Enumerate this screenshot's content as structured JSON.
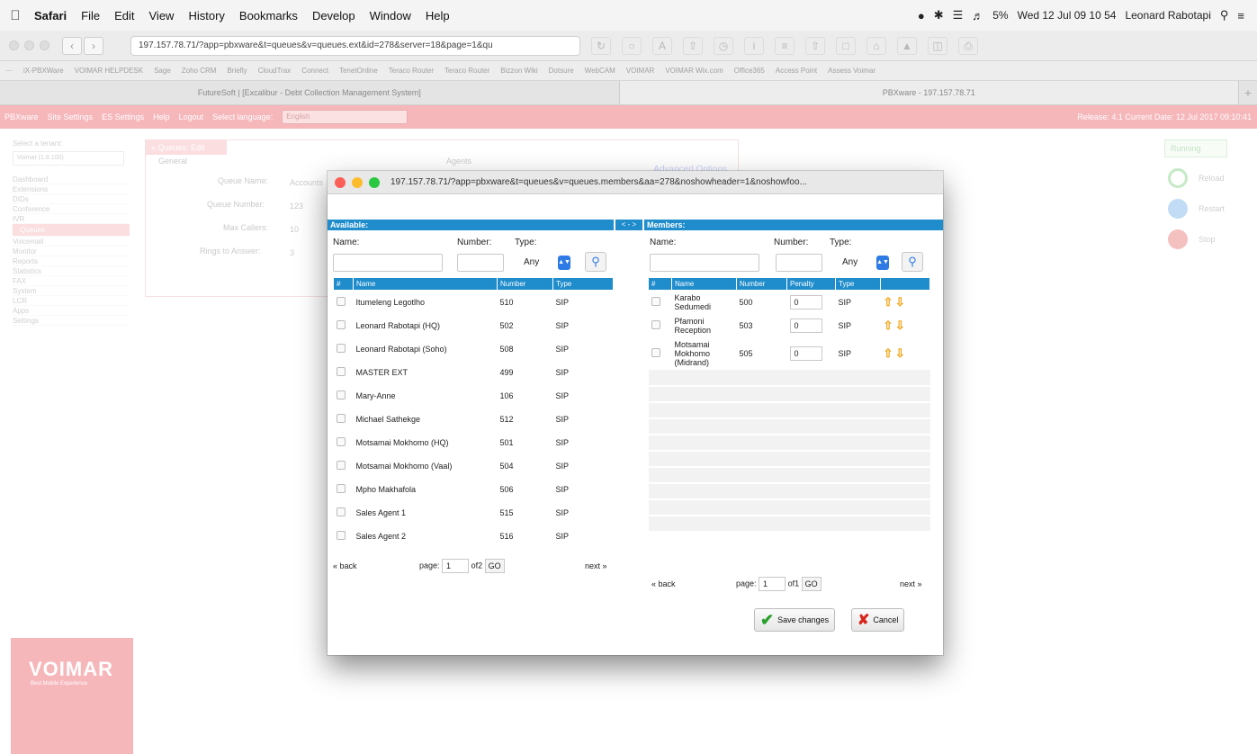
{
  "menubar": {
    "app": "Safari",
    "items": [
      "File",
      "Edit",
      "View",
      "History",
      "Bookmarks",
      "Develop",
      "Window",
      "Help"
    ],
    "battery": "5%",
    "clock": "Wed 12 Jul  09 10 54",
    "user": "Leonard Rabotapi"
  },
  "browser": {
    "url": "197.157.78.71/?app=pbxware&t=queues&v=queues.ext&id=278&server=18&page=1&qu",
    "bookmarks": [
      "iX-PBXWare",
      "VOIMAR HELPDESK",
      "Sage",
      "Zoho CRM",
      "Briefly",
      "CloudTrax",
      "Connect",
      "TenetOnline",
      "Teraco Router",
      "Teraco Router",
      "Bizzon Wiki",
      "Dotsure",
      "WebCAM",
      "VOIMAR",
      "VOIMAR Wix.com",
      "Office365",
      "Access Point",
      "Assess Voimar"
    ],
    "tabs": [
      "FutureSoft | [Excalibur - Debt Collection Management System]",
      "PBXware - 197.157.78.71"
    ]
  },
  "pbxbar": {
    "items": [
      "PBXware",
      "Site Settings",
      "ES Settings",
      "Help",
      "Logout",
      "Select language:"
    ],
    "language": "English",
    "right": "Release: 4.1   Current Date: 12 Jul 2017 09:10:41"
  },
  "background": {
    "tenant_label": "Select a tenant:",
    "tenant_value": "Voimar (1.8.100)",
    "nav": [
      "Dashboard",
      "Extensions",
      "DIDs",
      "Conference",
      "IVR",
      "Queues",
      "Voicemail",
      "Monitor",
      "Reports",
      "Statistics",
      "FAX",
      "System",
      "LCR",
      "Apps",
      "Settings"
    ],
    "selected_nav": "Queues",
    "panel_title": "« Queues: Edit",
    "advanced": "Advanced Options",
    "general": "General",
    "agents": "Agents",
    "fields": [
      "Queue Name:",
      "Queue Number:",
      "Max Callers:",
      "Rings to Answer:"
    ],
    "field_values": [
      "Accounts",
      "123",
      "10",
      "3"
    ],
    "status": "Running",
    "controls": [
      "Reload",
      "Restart",
      "Stop"
    ],
    "logo": "VOIMAR",
    "logo_tag": "Best Mobile Experience"
  },
  "modal": {
    "url": "197.157.78.71/?app=pbxware&t=queues&v=queues.members&aa=278&noshowheader=1&noshowfoo...",
    "available_title": "Available:",
    "swap_label": "< - >",
    "members_title": "Members:",
    "filters": {
      "name_label": "Name:",
      "number_label": "Number:",
      "type_label": "Type:",
      "type_value": "Any"
    },
    "available_columns": [
      "#",
      "Name",
      "Number",
      "Type"
    ],
    "available_rows": [
      {
        "name": "Itumeleng Legotlho",
        "number": "510",
        "type": "SIP"
      },
      {
        "name": "Leonard Rabotapi (HQ)",
        "number": "502",
        "type": "SIP"
      },
      {
        "name": "Leonard Rabotapi (Soho)",
        "number": "508",
        "type": "SIP"
      },
      {
        "name": "MASTER EXT",
        "number": "499",
        "type": "SIP"
      },
      {
        "name": "Mary-Anne",
        "number": "106",
        "type": "SIP"
      },
      {
        "name": "Michael Sathekge",
        "number": "512",
        "type": "SIP"
      },
      {
        "name": "Motsamai Mokhomo (HQ)",
        "number": "501",
        "type": "SIP"
      },
      {
        "name": "Motsamai Mokhomo (Vaal)",
        "number": "504",
        "type": "SIP"
      },
      {
        "name": "Mpho Makhafola",
        "number": "506",
        "type": "SIP"
      },
      {
        "name": "Sales Agent 1",
        "number": "515",
        "type": "SIP"
      },
      {
        "name": "Sales Agent 2",
        "number": "516",
        "type": "SIP"
      }
    ],
    "member_columns": [
      "#",
      "Name",
      "Number",
      "Penalty",
      "Type"
    ],
    "member_rows": [
      {
        "name": "Karabo Sedumedi",
        "number": "500",
        "penalty": "0",
        "type": "SIP"
      },
      {
        "name": "Pfamoni Reception",
        "number": "503",
        "penalty": "0",
        "type": "SIP"
      },
      {
        "name": "Motsamai Mokhomo (Midrand)",
        "number": "505",
        "penalty": "0",
        "type": "SIP"
      }
    ],
    "available_pager": {
      "back": "« back",
      "page_label": "page:",
      "page": "1",
      "of": "of2",
      "go": "GO",
      "next": "next »"
    },
    "members_pager": {
      "back": "« back",
      "page_label": "page:",
      "page": "1",
      "of": "of1",
      "go": "GO",
      "next": "next »"
    },
    "save_label": "Save changes",
    "cancel_label": "Cancel"
  },
  "colors": {
    "accent": "#1f8ccc",
    "pbx_pink": "#f6b7bb",
    "arrow": "#f4a312"
  }
}
